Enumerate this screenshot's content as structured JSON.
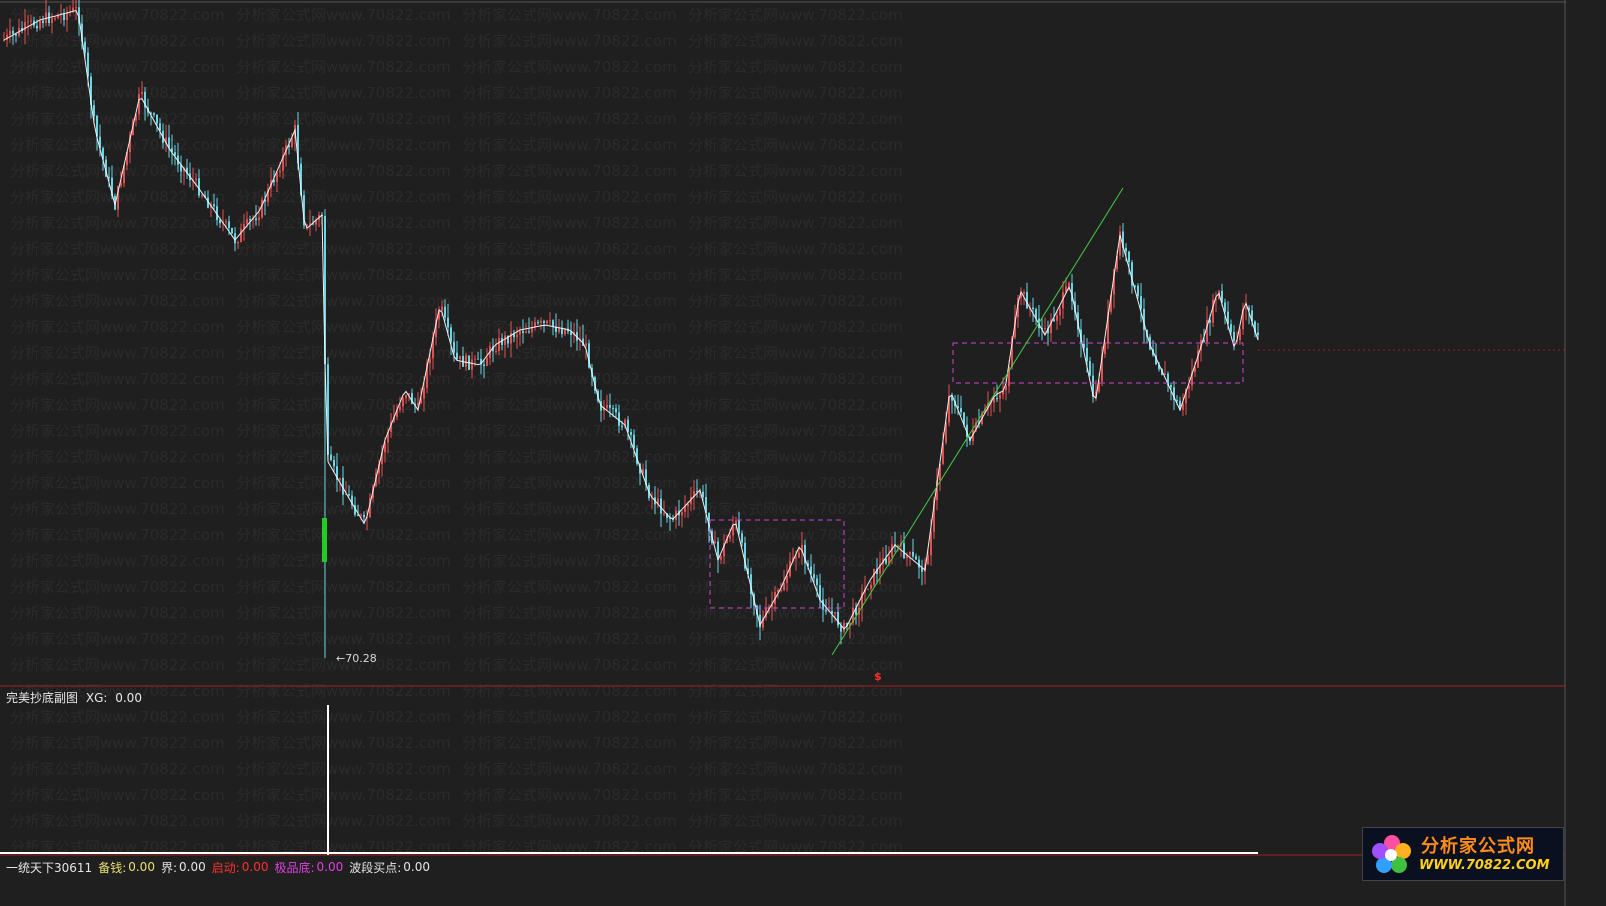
{
  "main_chart": {
    "low_label": "←70.28",
    "marker": "$"
  },
  "indicator": {
    "title": "完美抄底副图",
    "xg_label": "XG:",
    "xg_value": "0.00"
  },
  "status_bar": {
    "items": [
      {
        "label": "一统天下30611",
        "value": "",
        "color": "#e6e6e6"
      },
      {
        "label": "备钱:",
        "value": "0.00",
        "color": "#e8e070"
      },
      {
        "label": "界:",
        "value": "0.00",
        "color": "#e6e6e6"
      },
      {
        "label": "启动:",
        "value": "0.00",
        "color": "#ff3030"
      },
      {
        "label": "极品底:",
        "value": "0.00",
        "color": "#e040e0"
      },
      {
        "label": "波段买点:",
        "value": "0.00",
        "color": "#e6e6e6"
      }
    ]
  },
  "logo": {
    "title": "分析家公式网",
    "url": "WWW.70822.COM"
  },
  "watermark": {
    "text": "分析家公式网www.70822.com"
  },
  "colors": {
    "up": "#e05050",
    "down": "#6ad6e6",
    "ma": "#f0f0f0",
    "box": "#cc44cc",
    "trend": "#44cc44",
    "separator": "#a02020"
  }
}
